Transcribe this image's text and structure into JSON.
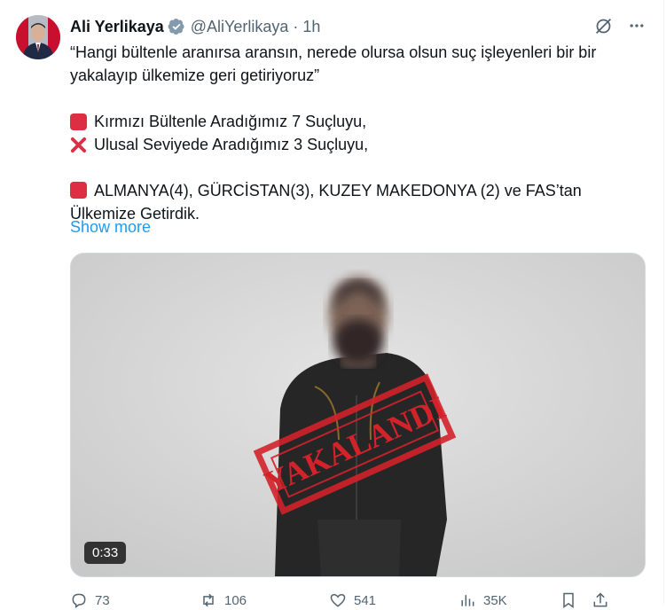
{
  "author": {
    "name": "Ali Yerlikaya",
    "handle": "@AliYerlikaya",
    "dot": "·",
    "time": "1h"
  },
  "tweet": {
    "quote": "“Hangi bültenle aranırsa aransın, nerede olursa olsun suç işleyenleri bir bir yakalayıp ülkemize geri getiriyoruz”",
    "line1": "Kırmızı Bültenle Aradığımız 7 Suçluyu,",
    "line2": "Ulusal Seviyede Aradığımız 3 Suçluyu,",
    "line3": "ALMANYA(4), GÜRCİSTAN(3), KUZEY MAKEDONYA (2) ve FAS’tan Ülkemize Getirdik.",
    "show_more": "Show more"
  },
  "media": {
    "stamp_text": "YAKALANDI",
    "duration": "0:33"
  },
  "actions": {
    "replies": "73",
    "reposts": "106",
    "likes": "541",
    "views": "35K"
  },
  "icons": {
    "verified": "verified-badge-icon",
    "grok": "grok-icon",
    "more": "more-icon",
    "reply": "reply-icon",
    "repost": "repost-icon",
    "like": "like-icon",
    "views": "views-icon",
    "bookmark": "bookmark-icon",
    "share": "share-icon",
    "red_square": "red-square-emoji",
    "cross_mark": "cross-mark-emoji"
  },
  "colors": {
    "accent": "#1d9bf0",
    "secondary_text": "#536471",
    "stamp_red": "#d3222a",
    "emoji_red": "#dd2e44"
  }
}
